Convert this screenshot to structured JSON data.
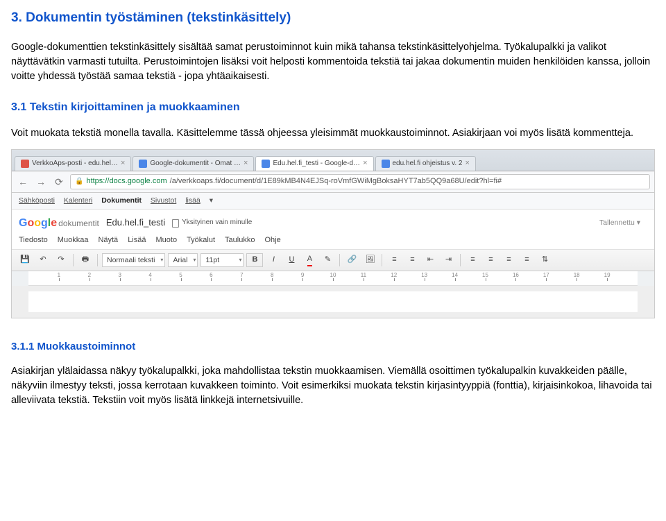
{
  "h2": "3. Dokumentin työstäminen (tekstinkäsittely)",
  "p1": "Google-dokumenttien tekstinkäsittely sisältää samat perustoiminnot kuin mikä tahansa tekstinkäsittelyohjelma. Työkalupalkki ja valikot näyttävätkin varmasti tutuilta. Perustoimintojen lisäksi voit helposti kommentoida tekstiä tai jakaa dokumentin muiden henkilöiden kanssa, jolloin voitte yhdessä työstää samaa tekstiä - jopa yhtäaikaisesti.",
  "h3": "3.1 Tekstin kirjoittaminen ja muokkaaminen",
  "p2": "Voit muokata tekstiä monella tavalla. Käsittelemme tässä ohjeessa yleisimmät muokkaustoiminnot. Asiakirjaan voi myös lisätä kommentteja.",
  "shot": {
    "tabs": [
      "VerkkoAps-posti - edu.hel…",
      "Google-dokumentit - Omat …",
      "Edu.hel.fi_testi - Google-d…",
      "edu.hel.fi ohjeistus v. 2"
    ],
    "url_host": "https://docs.google.com",
    "url_path": "/a/verkkoaps.fi/document/d/1E89kMB4N4EJSq-roVmfGWiMgBoksaHYT7ab5QQ9a68U/edit?hl=fi#",
    "svcs": [
      "Sähköposti",
      "Kalenteri",
      "Dokumentit",
      "Sivustot",
      "lisää"
    ],
    "logo_suffix": "dokumentit",
    "docname": "Edu.hel.fi_testi",
    "privacy": "Yksityinen vain minulle",
    "saved": "Tallennettu",
    "menus": [
      "Tiedosto",
      "Muokkaa",
      "Näytä",
      "Lisää",
      "Muoto",
      "Työkalut",
      "Taulukko",
      "Ohje"
    ],
    "style_sel": "Normaali teksti",
    "font_sel": "Arial",
    "size_sel": "11pt",
    "ruler_max": 19
  },
  "h4": "3.1.1 Muokkaustoiminnot",
  "p3": "Asiakirjan ylälaidassa näkyy työkalupalkki, joka mahdollistaa tekstin muokkaamisen. Viemällä osoittimen työkalupalkin kuvakkeiden päälle, näkyviin ilmestyy teksti, jossa kerrotaan kuvakkeen toiminto. Voit esimerkiksi muokata tekstin kirjasintyyppiä (fonttia), kirjaisinkokoa, lihavoida tai alleviivata tekstiä. Tekstiin voit myös lisätä linkkejä internetsivuille."
}
